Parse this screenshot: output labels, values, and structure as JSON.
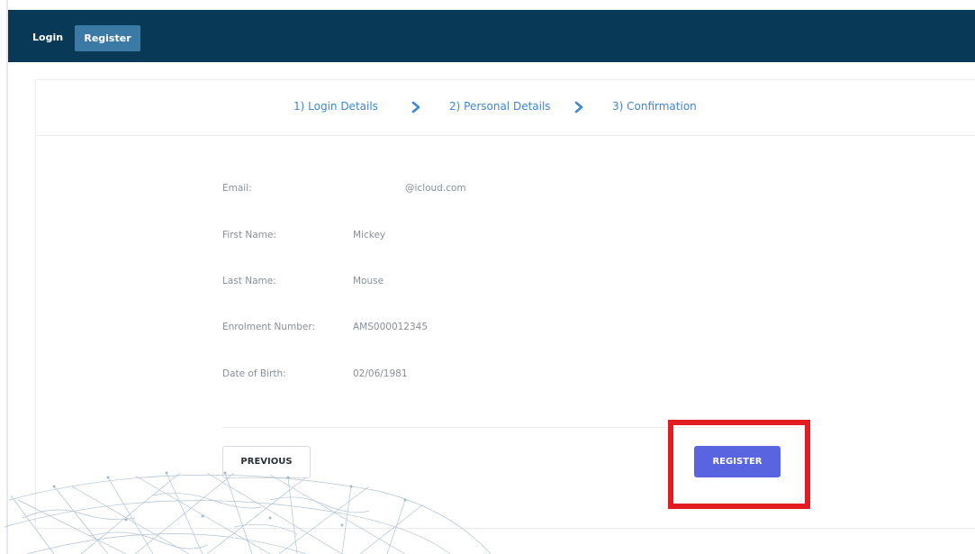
{
  "nav": {
    "login_label": "Login",
    "register_label": "Register"
  },
  "steps": {
    "step1": "1) Login Details",
    "step2": "2) Personal Details",
    "step3": "3) Confirmation"
  },
  "details": {
    "email_label": "Email:",
    "email_value": "@icloud.com",
    "first_name_label": "First Name:",
    "first_name_value": "Mickey",
    "last_name_label": "Last Name:",
    "last_name_value": "Mouse",
    "enrolment_label": "Enrolment Number:",
    "enrolment_value": "AMS000012345",
    "dob_label": "Date of Birth:",
    "dob_value": "02/06/1981"
  },
  "actions": {
    "previous_label": "PREVIOUS",
    "register_label": "REGISTER"
  },
  "colors": {
    "topbar": "#083a57",
    "nav_active": "#3c7aa6",
    "step_link": "#3e86d8",
    "primary_button": "#5965e0",
    "highlight": "#e31b23"
  },
  "icons": {
    "step_separator": "chevron-right-icon",
    "background_art": "world-globe-network-icon"
  }
}
